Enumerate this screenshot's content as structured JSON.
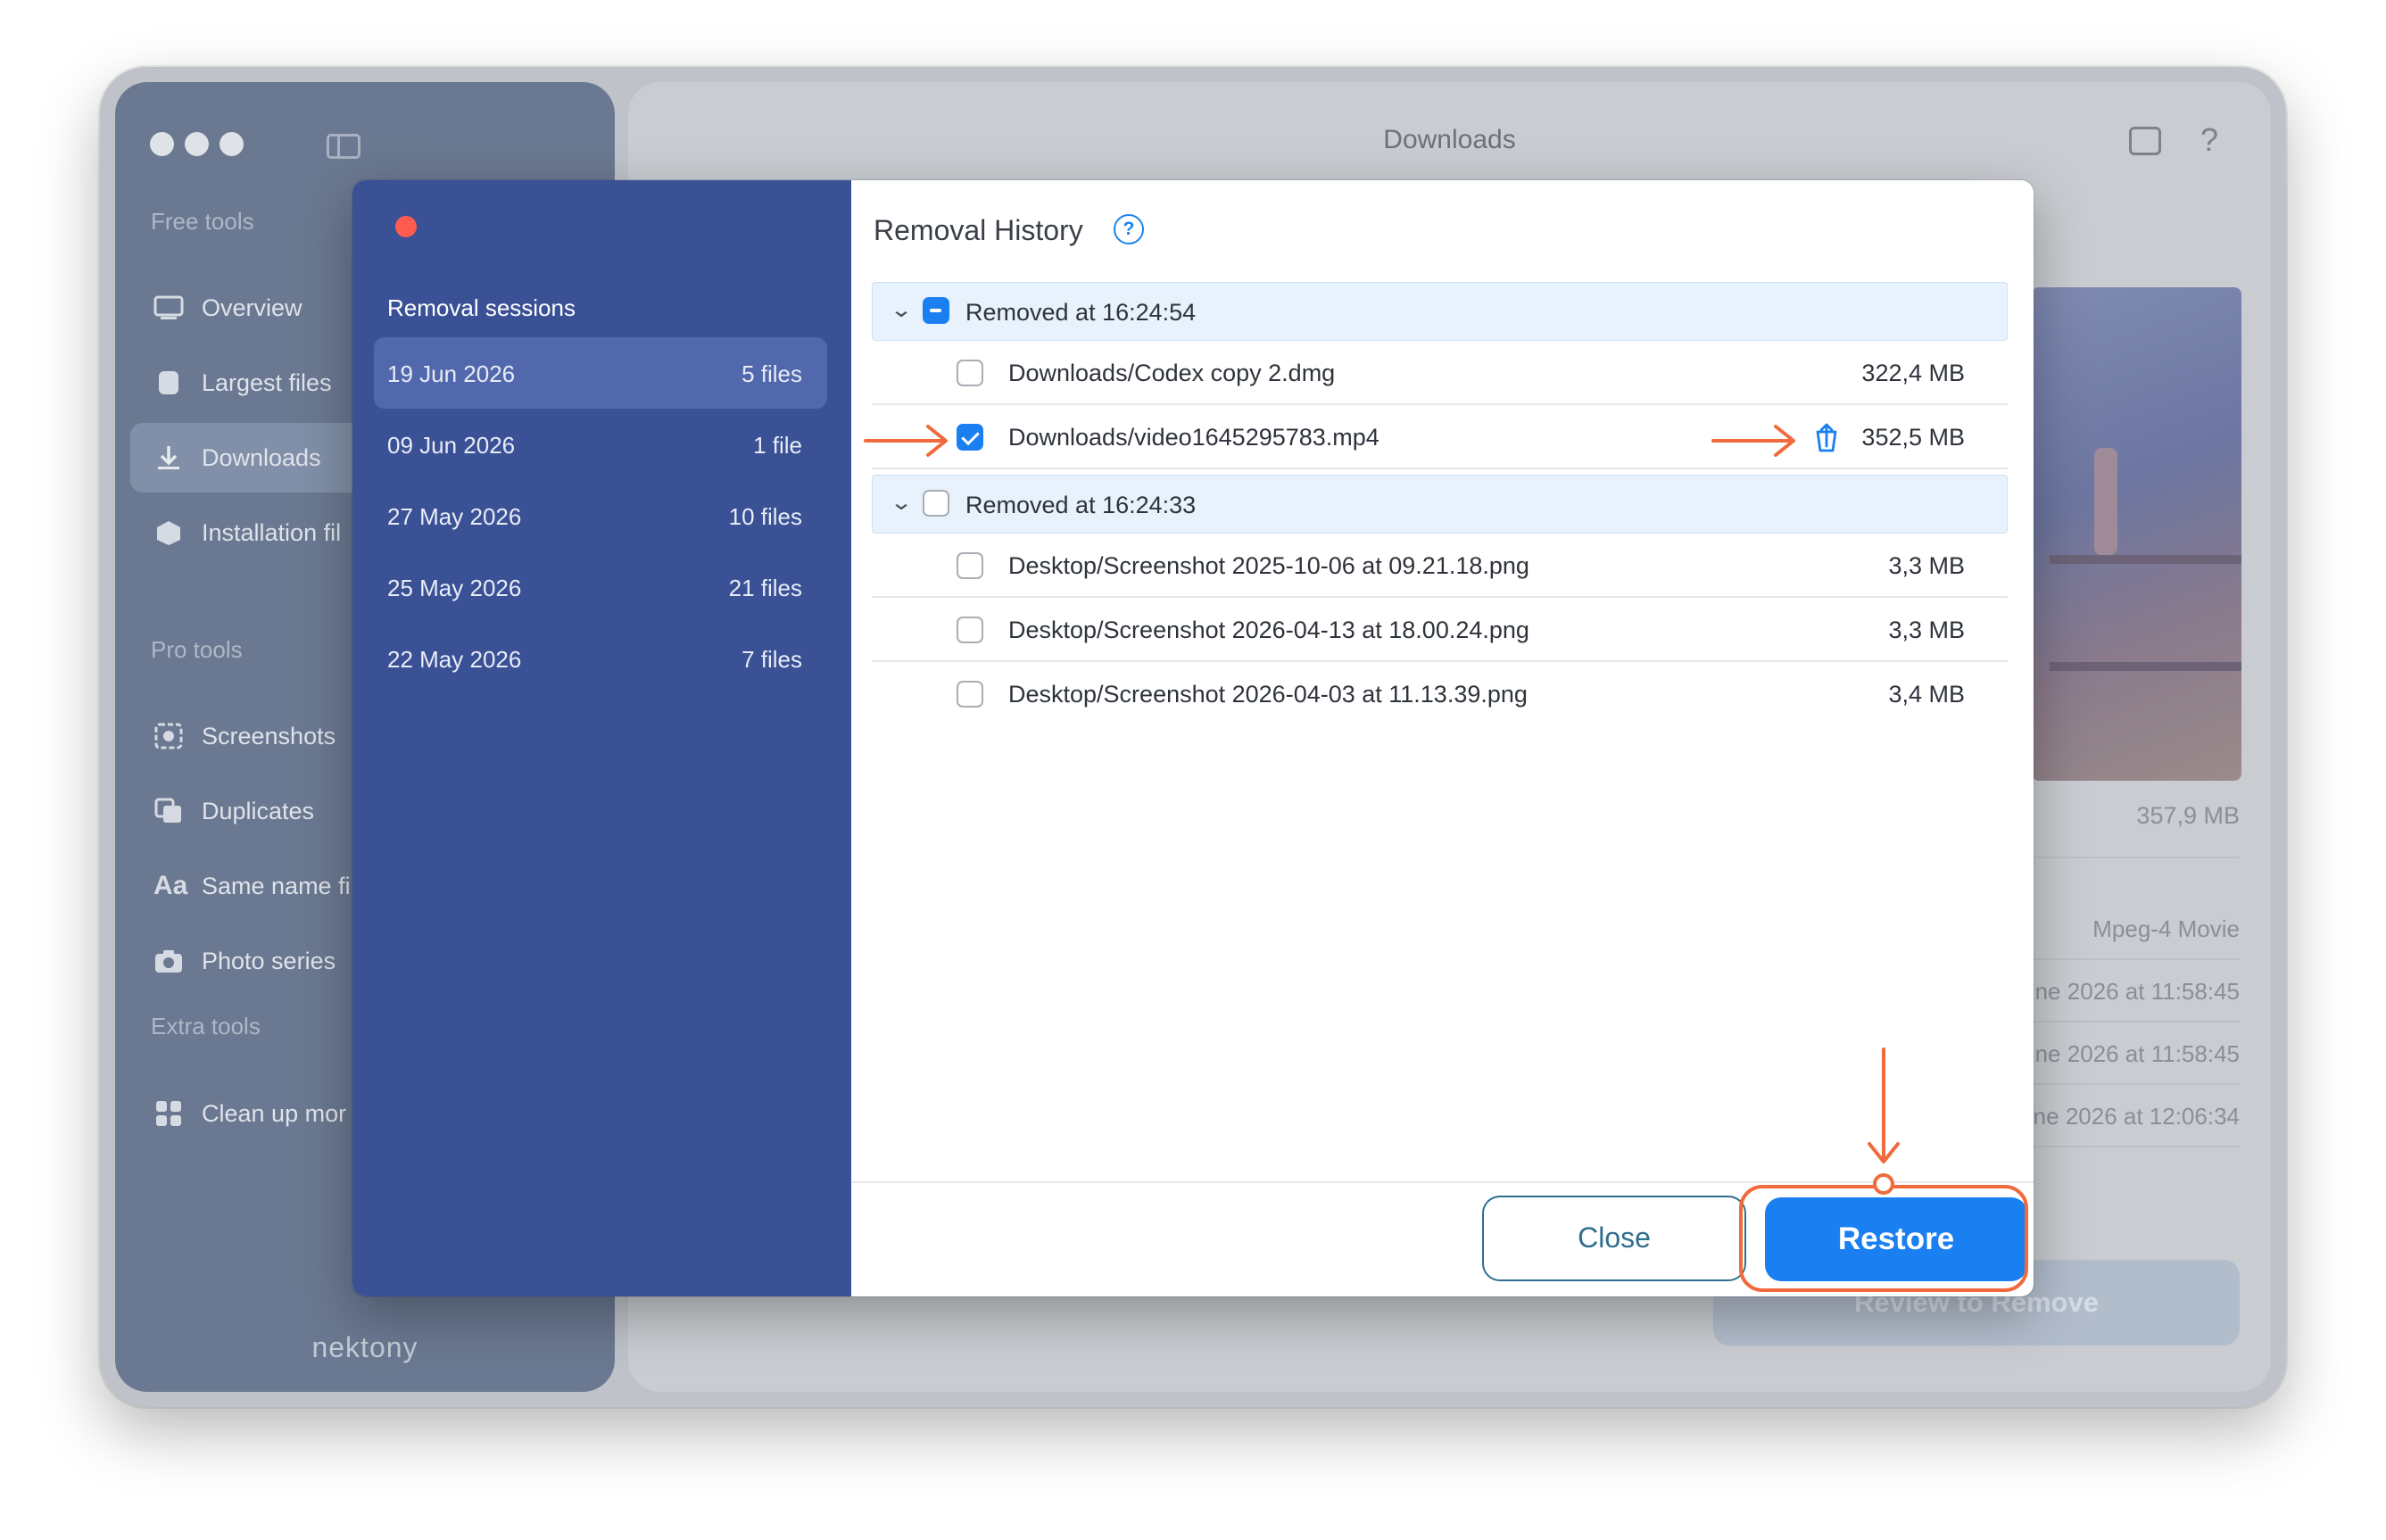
{
  "window": {
    "title": "Downloads",
    "help_glyph": "?",
    "brand": "nektony"
  },
  "sidebar": {
    "sections": [
      {
        "label": "Free tools",
        "items": [
          {
            "label": "Overview",
            "icon": "overview-icon",
            "active": false
          },
          {
            "label": "Largest files",
            "icon": "largest-files-icon",
            "active": false
          },
          {
            "label": "Downloads",
            "icon": "downloads-icon",
            "active": true
          },
          {
            "label": "Installation fil",
            "icon": "installation-files-icon",
            "active": false
          }
        ]
      },
      {
        "label": "Pro tools",
        "items": [
          {
            "label": "Screenshots",
            "icon": "screenshots-icon",
            "active": false
          },
          {
            "label": "Duplicates",
            "icon": "duplicates-icon",
            "active": false
          },
          {
            "label": "Same name fi",
            "icon": "same-name-icon",
            "active": false
          },
          {
            "label": "Photo series",
            "icon": "photo-series-icon",
            "active": false
          }
        ]
      },
      {
        "label": "Extra tools",
        "items": [
          {
            "label": "Clean up mor",
            "icon": "clean-up-icon",
            "active": false
          }
        ]
      }
    ]
  },
  "details": {
    "size": "357,9 MB",
    "kind": "Mpeg-4 Movie",
    "dates": [
      "ne 2026 at 11:58:45",
      "ne 2026 at 11:58:45",
      "ne 2026 at 12:06:34"
    ],
    "review_button": "Review to Remove"
  },
  "modal": {
    "sessions_title": "Removal sessions",
    "sessions": [
      {
        "date": "19 Jun 2026",
        "count": "5 files",
        "active": true
      },
      {
        "date": "09 Jun 2026",
        "count": "1 file",
        "active": false
      },
      {
        "date": "27 May 2026",
        "count": "10 files",
        "active": false
      },
      {
        "date": "25 May 2026",
        "count": "21 files",
        "active": false
      },
      {
        "date": "22 May 2026",
        "count": "7 files",
        "active": false
      }
    ],
    "title": "Removal History",
    "help_glyph": "?",
    "groups": [
      {
        "label": "Removed at 16:24:54",
        "state": "mixed",
        "files": [
          {
            "name": "Downloads/Codex copy 2.dmg",
            "size": "322,4 MB",
            "checked": false,
            "restore_icon": false
          },
          {
            "name": "Downloads/video1645295783.mp4",
            "size": "352,5 MB",
            "checked": true,
            "restore_icon": true
          }
        ]
      },
      {
        "label": "Removed at 16:24:33",
        "state": "unchecked",
        "files": [
          {
            "name": "Desktop/Screenshot 2025-10-06 at 09.21.18.png",
            "size": "3,3 MB",
            "checked": false,
            "restore_icon": false
          },
          {
            "name": "Desktop/Screenshot 2026-04-13 at 18.00.24.png",
            "size": "3,3 MB",
            "checked": false,
            "restore_icon": false
          },
          {
            "name": "Desktop/Screenshot 2026-04-03 at 11.13.39.png",
            "size": "3,4 MB",
            "checked": false,
            "restore_icon": false
          }
        ]
      }
    ],
    "close_button": "Close",
    "restore_button": "Restore"
  },
  "colors": {
    "accent": "#1a7ff0",
    "annotation": "#f06a3c",
    "modal_sidebar": "#3a5196"
  }
}
